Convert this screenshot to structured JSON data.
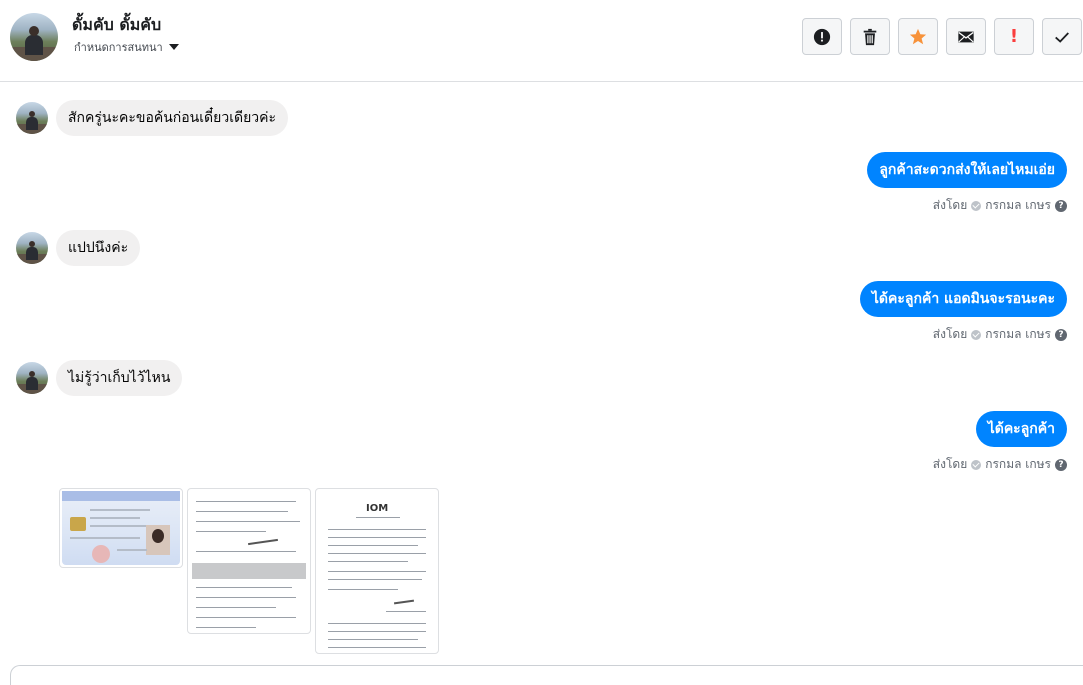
{
  "header": {
    "contact_name": "ดั้มคับ ดั้มคับ",
    "assign_label": "กำหนดการสนทนา",
    "tools": [
      {
        "name": "mark-spam-button",
        "icon": "alert-circle-icon",
        "color": "#1c1e21"
      },
      {
        "name": "delete-button",
        "icon": "trash-icon",
        "color": "#1c1e21"
      },
      {
        "name": "star-button",
        "icon": "star-icon",
        "color": "#f7923a"
      },
      {
        "name": "mark-unread-button",
        "icon": "envelope-icon",
        "color": "#1c1e21"
      },
      {
        "name": "flag-important-button",
        "icon": "exclamation-icon",
        "color": "#fa3e3e",
        "text": "!"
      },
      {
        "name": "mark-done-button",
        "icon": "check-icon",
        "color": "#1c1e21"
      }
    ]
  },
  "messages": [
    {
      "direction": "in",
      "text": "สักครู่นะคะขอค้นก่อนเดี๋ยวเดียวค่ะ"
    },
    {
      "direction": "out",
      "text": "ลูกค้าสะดวกส่งให้เลยไหมเอ่ย",
      "sent_by_label": "ส่งโดย",
      "sender": "กรกมล เกษร"
    },
    {
      "direction": "in",
      "text": "แปปนึงค่ะ"
    },
    {
      "direction": "out",
      "text": "ได้คะลูกค้า แอดมินจะรอนะคะ",
      "sent_by_label": "ส่งโดย",
      "sender": "กรกมล เกษร"
    },
    {
      "direction": "in",
      "text": "ไม่รู้ว่าเก็บไว้ไหน"
    },
    {
      "direction": "out",
      "text": "ได้คะลูกค้า",
      "sent_by_label": "ส่งโดย",
      "sender": "กรกมล เกษร"
    }
  ],
  "attachments": [
    {
      "kind": "id-card-image"
    },
    {
      "kind": "form-document-image"
    },
    {
      "kind": "letter-document-image",
      "logo_text": "IOM"
    }
  ],
  "colors": {
    "outgoing_bubble": "#0084ff",
    "incoming_bubble": "#f1f0f0",
    "star": "#f7923a",
    "important": "#fa3e3e"
  }
}
